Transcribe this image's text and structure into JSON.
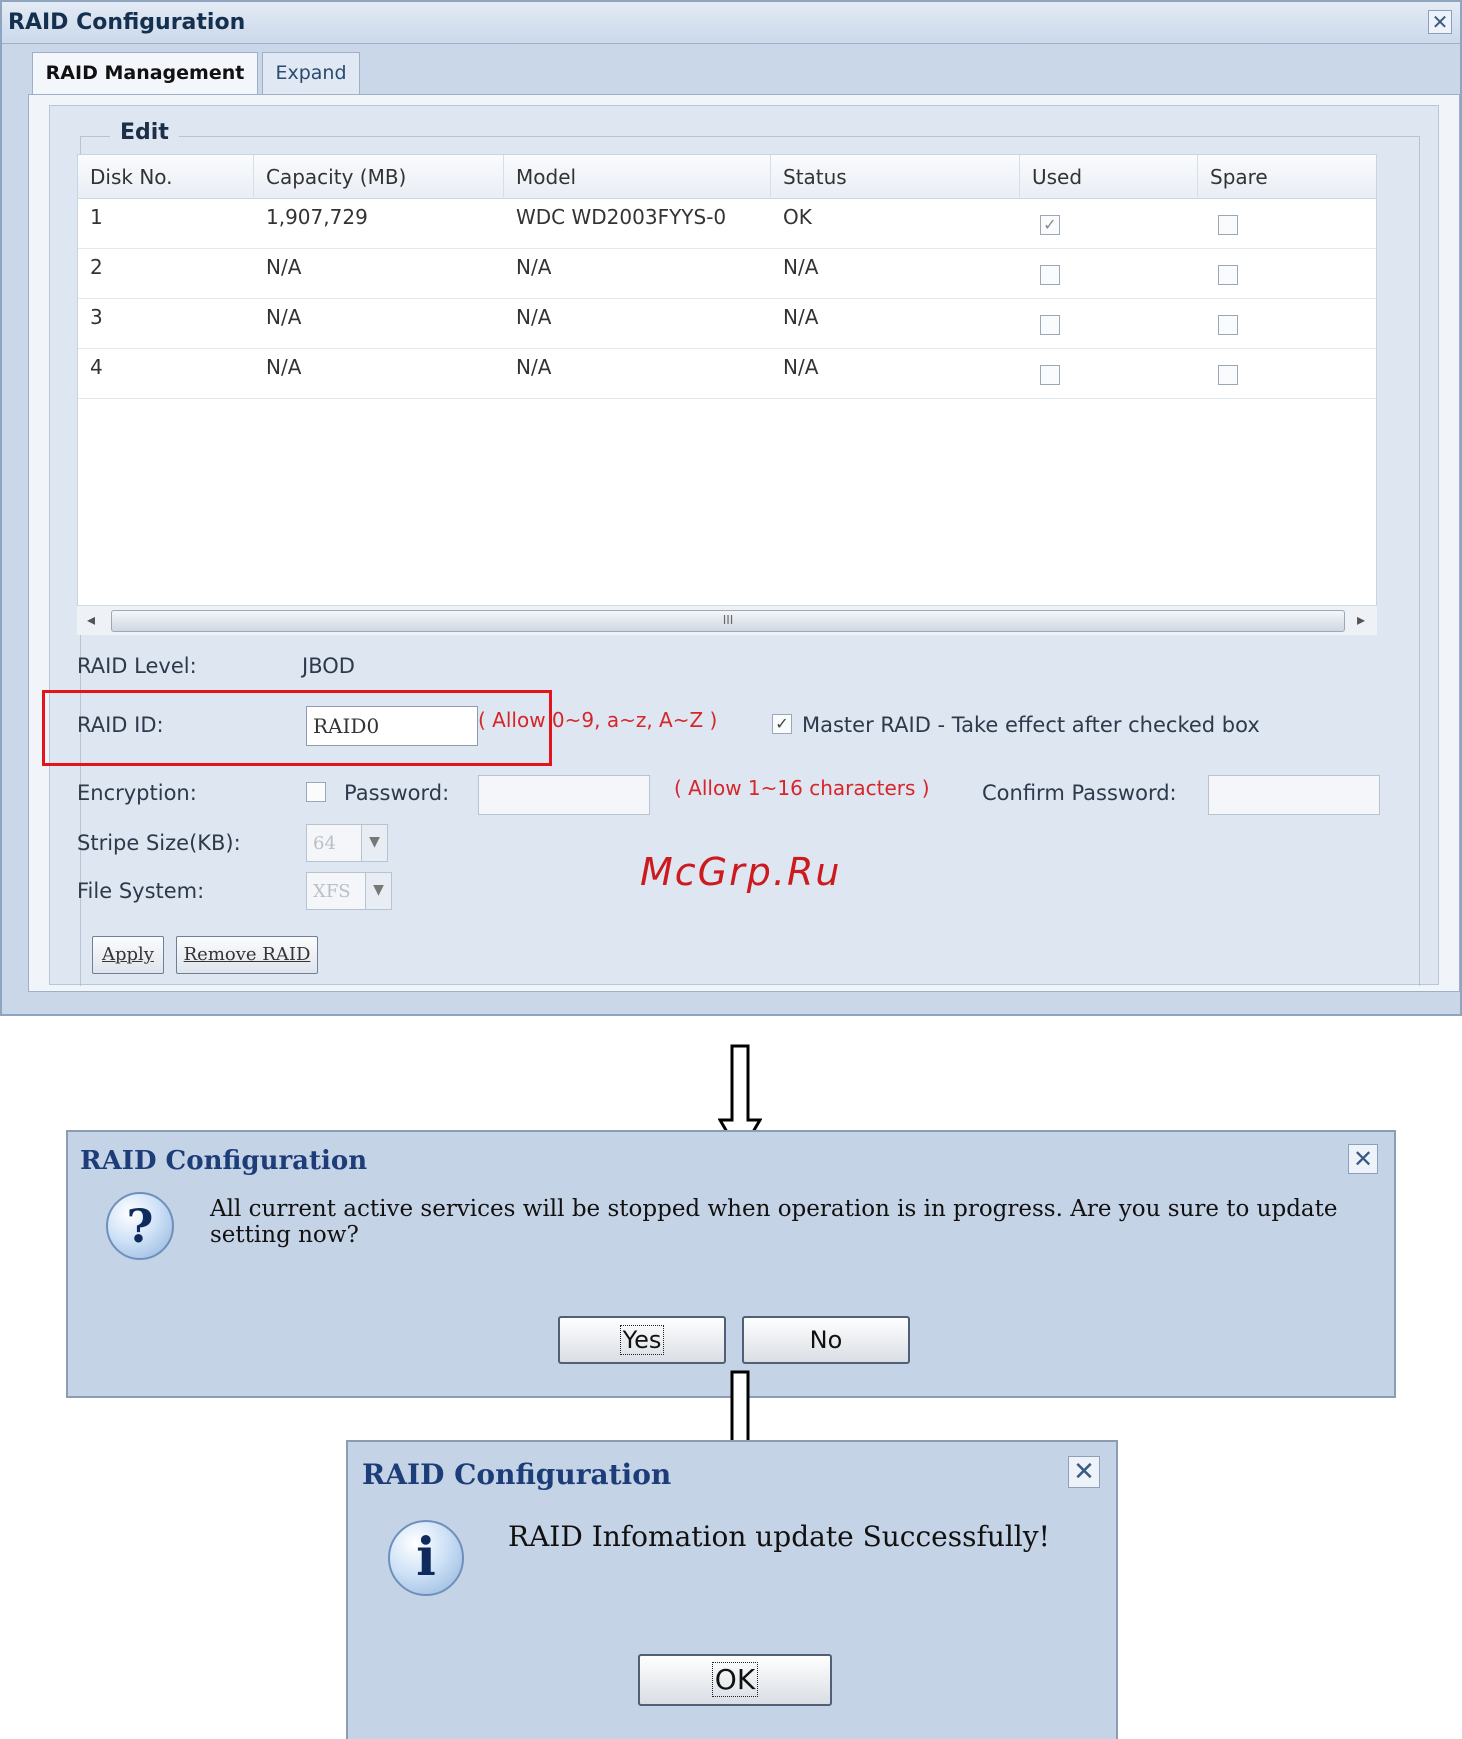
{
  "main_window": {
    "title": "RAID Configuration",
    "close_glyph": "✕",
    "tabs": [
      {
        "label": "RAID Management",
        "active": true
      },
      {
        "label": "Expand",
        "active": false
      }
    ],
    "fieldset_legend": "Edit",
    "table": {
      "columns": [
        "Disk No.",
        "Capacity (MB)",
        "Model",
        "Status",
        "Used",
        "Spare"
      ],
      "rows": [
        {
          "disk": "1",
          "capacity": "1,907,729",
          "model": "WDC WD2003FYYS-0",
          "status": "OK",
          "used": true,
          "spare": false
        },
        {
          "disk": "2",
          "capacity": "N/A",
          "model": "N/A",
          "status": "N/A",
          "used": false,
          "spare": false
        },
        {
          "disk": "3",
          "capacity": "N/A",
          "model": "N/A",
          "status": "N/A",
          "used": false,
          "spare": false
        },
        {
          "disk": "4",
          "capacity": "N/A",
          "model": "N/A",
          "status": "N/A",
          "used": false,
          "spare": false
        }
      ]
    },
    "scroll": {
      "left": "◂",
      "thumb": "III",
      "right": "▸"
    },
    "form": {
      "raid_level_label": "RAID Level:",
      "raid_level_value": "JBOD",
      "raid_id_label": "RAID ID:",
      "raid_id_value": "RAID0",
      "raid_id_hint": "( Allow 0~9, a~z, A~Z )",
      "master_raid_label": "Master RAID - Take effect after checked box",
      "master_raid_checked": true,
      "encryption_label": "Encryption:",
      "password_label": "Password:",
      "password_hint": "( Allow 1~16 characters )",
      "confirm_password_label": "Confirm Password:",
      "stripe_size_label": "Stripe Size(KB):",
      "stripe_size_value": "64",
      "file_system_label": "File System:",
      "file_system_value": "XFS",
      "apply_label": "Apply",
      "remove_label": "Remove RAID"
    }
  },
  "watermark": "McGrp.Ru",
  "confirm_dialog": {
    "title": "RAID Configuration",
    "close_glyph": "✕",
    "icon": "question-icon",
    "icon_glyph": "?",
    "message": "All current active services will be stopped when operation is in progress. Are you sure to update setting now?",
    "yes_label": "Yes",
    "no_label": "No"
  },
  "info_dialog": {
    "title": "RAID Configuration",
    "close_glyph": "✕",
    "icon": "info-icon",
    "icon_glyph": "i",
    "message": "RAID Infomation update Successfully!",
    "ok_label": "OK"
  },
  "colors": {
    "accent_red": "#e2141c",
    "title_blue": "#1c3d78",
    "dialog_bg": "#c5d3e6"
  }
}
